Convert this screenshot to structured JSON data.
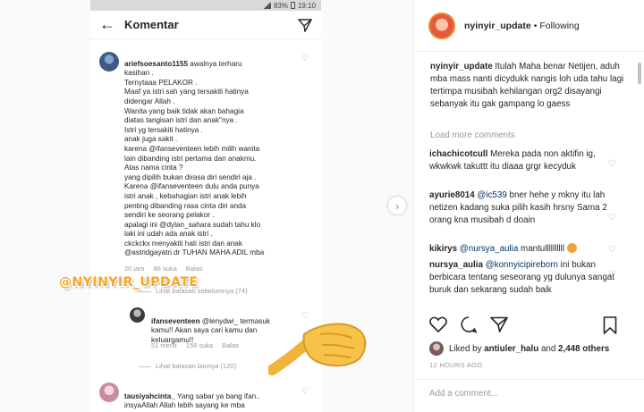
{
  "phone": {
    "status_battery": "83%",
    "status_time": "19:10",
    "header_title": "Komentar",
    "comments": [
      {
        "user": "ariefsoesanto1155",
        "text": "awalnya terharu\nkasihan .\nTernytaaa PELAKOR .\nMaaf ya istri sah yang tersakiti hatinya\ndidengar Allah .\nWanita yang baik tidak akan bahagia\ndiatas tangisan istri dan anak\"nya .\nIstri yg tersakiti hatinya .\nanak juga sakit .\nkarena @ifanseventeen lebih milih wanita\nlain dibanding istri pertama dan anakmu.\nAtas nama cinta ?\nyang dipilih bukan dirasa diri sendiri aja .\nKarena @ifanseventeen dulu anda punya\nistri anak , kebahagian istri anak lebih\npenting dibanding rasa cinta diri anda\nsendiri ke seorang pelakor .\napalagi ini @dylan_sahara sudah tahu klo\nlaki ini udah ada anak istri .\nckckckx menyakiti hati istri dan anak\n@astridgayatri.dr TUHAN MAHA ADIL mba",
        "time": "20 jam",
        "likes": "86 suka",
        "reply": "Balas"
      },
      {
        "user": "ifanseventeen",
        "text": "@lenydwi_ termasuk\nkamu!! Akan saya cari kamu dan\nkeluargamu!!",
        "time": "51 menit",
        "likes": "159 suka",
        "reply": "Balas"
      },
      {
        "user": "tausiyahcinta_",
        "text": "Yang sabar ya bang ifan..\ninsyaAllah Allah lebih sayang ke mba\ndylan"
      }
    ],
    "hidden_replies_top": "Lihat balasan sebelumnya (74)",
    "more_replies": "Lihat balasan lainnya (120)",
    "watermark": "@NYINYIR_UPDATE"
  },
  "post": {
    "username": "nyinyir_update",
    "dot": "•",
    "follow_status": "Following",
    "caption_user": "nyinyir_update",
    "caption_text": "Itulah Maha benar Netijen, aduh mba mass nanti dicydukk nangis loh uda tahu lagi tertimpa musibah kehilangan org2 disayangi sebanyak itu gak gampang lo gaess",
    "load_more": "Load more comments",
    "comments": [
      {
        "user": "ichachicotcull",
        "text": "Mereka pada non aktifin ig, wkwkwk takuttt itu diaaa grgr kecyduk"
      },
      {
        "user": "ayurie8014",
        "mention": "@ic539",
        "text": "bner hehe y mkny itu lah netizen kadang suka pilih kasih hrsny Sama 2 orang kna musibah d doain"
      },
      {
        "user": "kikirys",
        "mention": "@nursya_aulia",
        "text": "mantullllllllll"
      },
      {
        "user": "nursya_aulia",
        "mention": "@konnyicipireborn",
        "text": "ini bukan berbicara tentang seseorang yg dulunya sangat buruk dan sekarang sudah baik"
      }
    ],
    "liked_prefix": "Liked by",
    "liked_user": "antiuler_halu",
    "liked_and": "and",
    "liked_count": "2,448 others",
    "timestamp": "12 HOURS AGO",
    "add_comment_placeholder": "Add a comment..."
  },
  "colors": {
    "accent_link": "#003569",
    "muted": "#999999",
    "watermark": "#f5a623"
  }
}
